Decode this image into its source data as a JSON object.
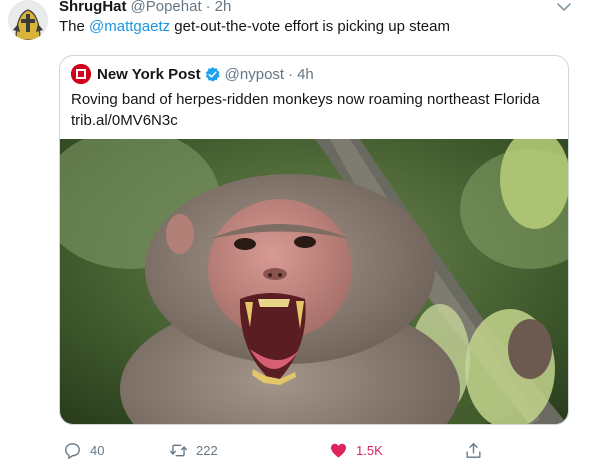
{
  "tweet": {
    "author": {
      "display_name": "ShrugHat",
      "handle": "@Popehat",
      "time": "2h"
    },
    "dot": "·",
    "text_before": "The ",
    "mention": "@mattgaetz",
    "text_after": " get-out-the-vote effort is picking up steam"
  },
  "quoted_tweet": {
    "author": {
      "display_name": "New York Post",
      "handle": "@nypost",
      "time": "4h"
    },
    "dot": "·",
    "text": "Roving band of herpes-ridden monkeys now roaming northeast Florida",
    "link": "trib.al/0MV6N3c",
    "photo_icon": "monkey-photo"
  },
  "actions": {
    "reply_count": "40",
    "retweet_count": "222",
    "like_count": "1.5K",
    "icons": [
      "reply-icon",
      "retweet-icon",
      "heart-icon",
      "share-icon"
    ]
  },
  "colors": {
    "link": "#1b95e0",
    "secondary_text": "#657786",
    "like": "#e0245e",
    "verified": "#1da1f2",
    "nypost_red": "#d0021b"
  }
}
